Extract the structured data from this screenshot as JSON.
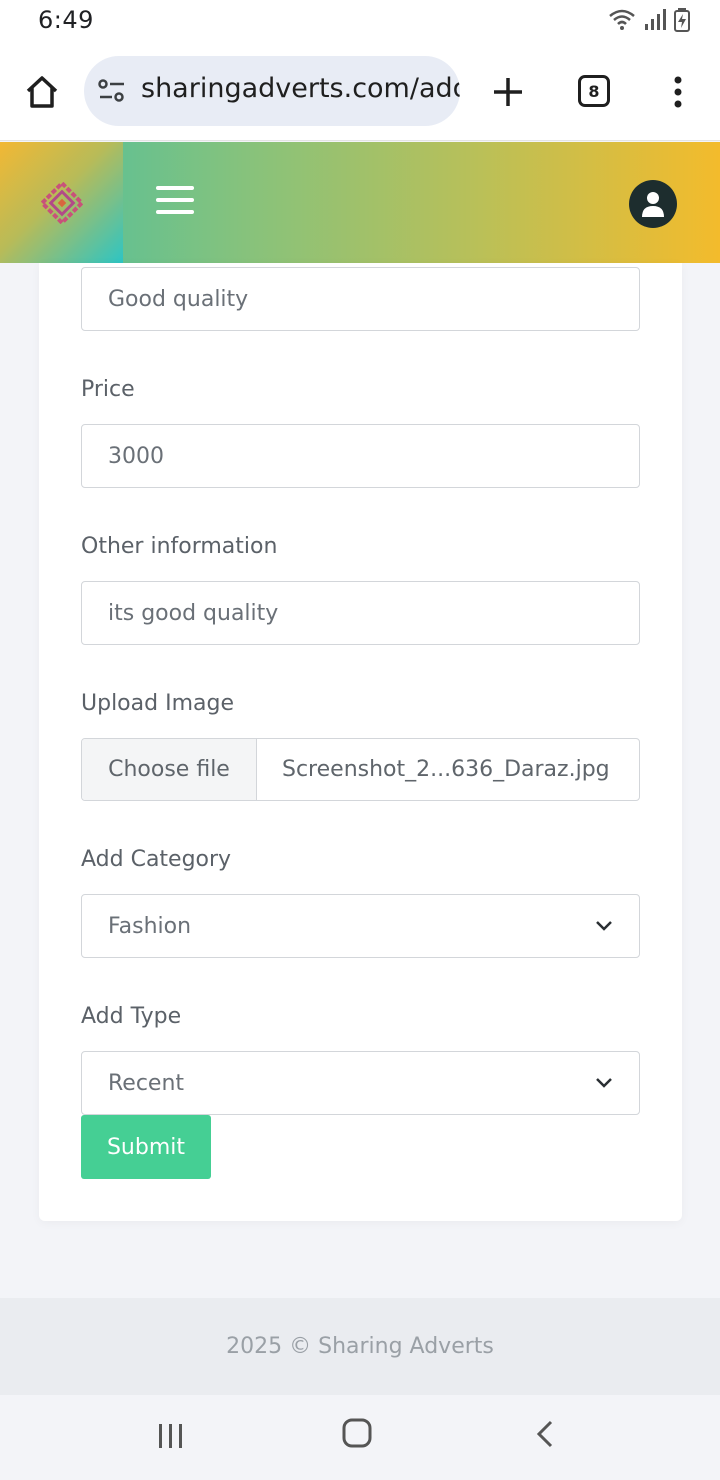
{
  "status": {
    "time": "6:49"
  },
  "browser": {
    "url": "sharingadverts.com/add",
    "tab_count": "8"
  },
  "form": {
    "description_value": "Good quality",
    "price": {
      "label": "Price",
      "value": "3000"
    },
    "other": {
      "label": "Other information",
      "value": "its good quality"
    },
    "upload": {
      "label": "Upload Image",
      "button": "Choose file",
      "filename": "Screenshot_2...636_Daraz.jpg"
    },
    "category": {
      "label": "Add Category",
      "selected": "Fashion"
    },
    "type": {
      "label": "Add Type",
      "selected": "Recent"
    },
    "submit_label": "Submit"
  },
  "footer": {
    "text": "2025 © Sharing Adverts"
  },
  "colors": {
    "accent": "#45cf94",
    "header_start": "#48c0a2",
    "header_end": "#f3bb2c"
  }
}
